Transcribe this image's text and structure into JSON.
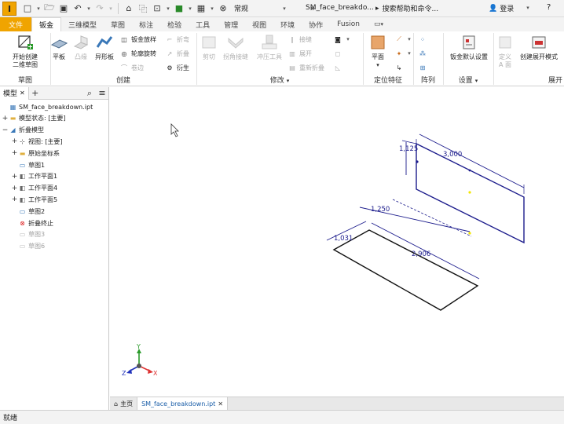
{
  "app": {
    "logo_letter": "I"
  },
  "quick_access": {
    "material_value": "常规"
  },
  "title": {
    "document": "SM_face_breakdo...",
    "help_placeholder": "搜索帮助和命令...",
    "login": "登录"
  },
  "tabs": [
    "文件",
    "钣金",
    "三维模型",
    "草图",
    "标注",
    "检验",
    "工具",
    "管理",
    "视图",
    "环境",
    "协作",
    "Fusion"
  ],
  "ribbon": {
    "sketch": {
      "start_sketch": "开始创建\n二维草图",
      "label": "草图"
    },
    "create": {
      "face": "平板",
      "contour_flange": "凸缘",
      "contour_roll": "异形板",
      "lofted_flange": "钣金放样",
      "contour_roll2": "轮廓旋转",
      "cut": "卷边",
      "fold": "折弯",
      "unfold": "折叠",
      "derive": "衍生",
      "label": "创建"
    },
    "modify": {
      "cut": "剪切",
      "corner_seam": "拐角接缝",
      "punch_tool": "冲压工具",
      "bend": "接缝",
      "unfold": "展开",
      "refold": "重新折叠",
      "label": "修改"
    },
    "locate": {
      "plane": "平面",
      "label": "定位特征"
    },
    "pattern": {
      "label": "阵列"
    },
    "setup": {
      "sheet_metal_defaults": "钣金默认设置",
      "label": "设置"
    },
    "define": {
      "define_a_side": "定义\nA 面",
      "create_flat_pattern": "创建展开模式",
      "label": "展开"
    }
  },
  "browser": {
    "tab_label": "模型",
    "items": [
      {
        "label": "SM_face_breakdown.ipt",
        "icon": "part-icon",
        "exp": "",
        "dim": false
      },
      {
        "label": "模型状态: [主要]",
        "icon": "folder-icon",
        "exp": "+",
        "dim": false
      },
      {
        "label": "折叠模型",
        "icon": "sheet-metal-icon",
        "exp": "−",
        "dim": false
      },
      {
        "label": "视图: [主要]",
        "icon": "view-icon",
        "exp": "+",
        "dim": false
      },
      {
        "label": "原始坐标系",
        "icon": "folder-icon",
        "exp": "+",
        "dim": false
      },
      {
        "label": "草图1",
        "icon": "sketch-icon",
        "exp": "",
        "dim": false
      },
      {
        "label": "工作平面1",
        "icon": "workplane-icon",
        "exp": "+",
        "dim": false
      },
      {
        "label": "工作平面4",
        "icon": "workplane-icon",
        "exp": "+",
        "dim": false
      },
      {
        "label": "工作平面5",
        "icon": "workplane-icon",
        "exp": "+",
        "dim": false
      },
      {
        "label": "草图2",
        "icon": "sketch-icon",
        "exp": "",
        "dim": false
      },
      {
        "label": "折叠终止",
        "icon": "end-of-folded-icon",
        "exp": "",
        "dim": false
      },
      {
        "label": "草图3",
        "icon": "sketch-icon",
        "exp": "",
        "dim": true
      },
      {
        "label": "草图6",
        "icon": "sketch-icon",
        "exp": "",
        "dim": true
      }
    ]
  },
  "canvas": {
    "dims": {
      "d1": "1,125",
      "d2": "3,000",
      "d3": "1,250",
      "d4": "1,031",
      "d5": "2,906"
    },
    "triad": {
      "x": "X",
      "y": "Y",
      "z": "Z"
    },
    "colors": {
      "sketch": "#1c1c8c",
      "dim": "#1c1c8c",
      "point": "#f2e600"
    }
  },
  "doc_tabs": {
    "home": "主页",
    "file": "SM_face_breakdown.ipt"
  },
  "status": "就绪"
}
